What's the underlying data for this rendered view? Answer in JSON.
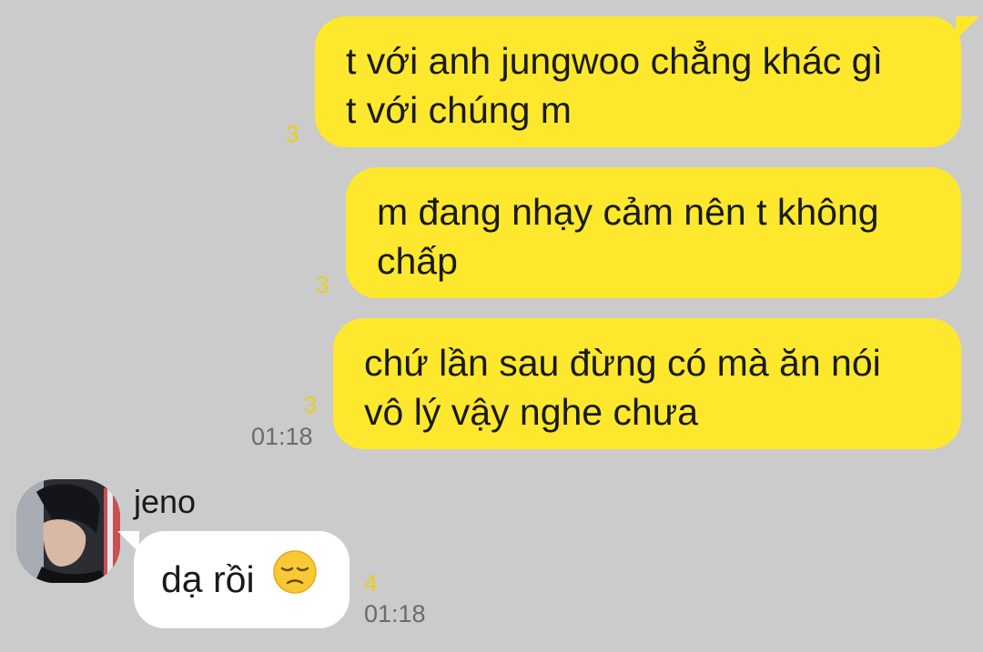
{
  "messages_out": [
    {
      "text": "t với anh jungwoo chẳng khác gì\nt với chúng m",
      "unread": "3"
    },
    {
      "text": "m đang nhạy cảm nên t không\nchấp",
      "unread": "3"
    },
    {
      "text": "chứ lần sau đừng có mà ăn nói\nvô lý vậy nghe chưa",
      "unread": "3",
      "time": "01:18"
    }
  ],
  "incoming": {
    "sender": "jeno",
    "text": "dạ rồi",
    "emoji": "pensive-face-emoji",
    "unread": "4",
    "time": "01:18"
  },
  "colors": {
    "background": "#cbcbcb",
    "outgoing_bubble": "#fee82d",
    "incoming_bubble": "#ffffff",
    "unread_count": "#e6cf18",
    "timestamp": "#6b6b6b"
  }
}
